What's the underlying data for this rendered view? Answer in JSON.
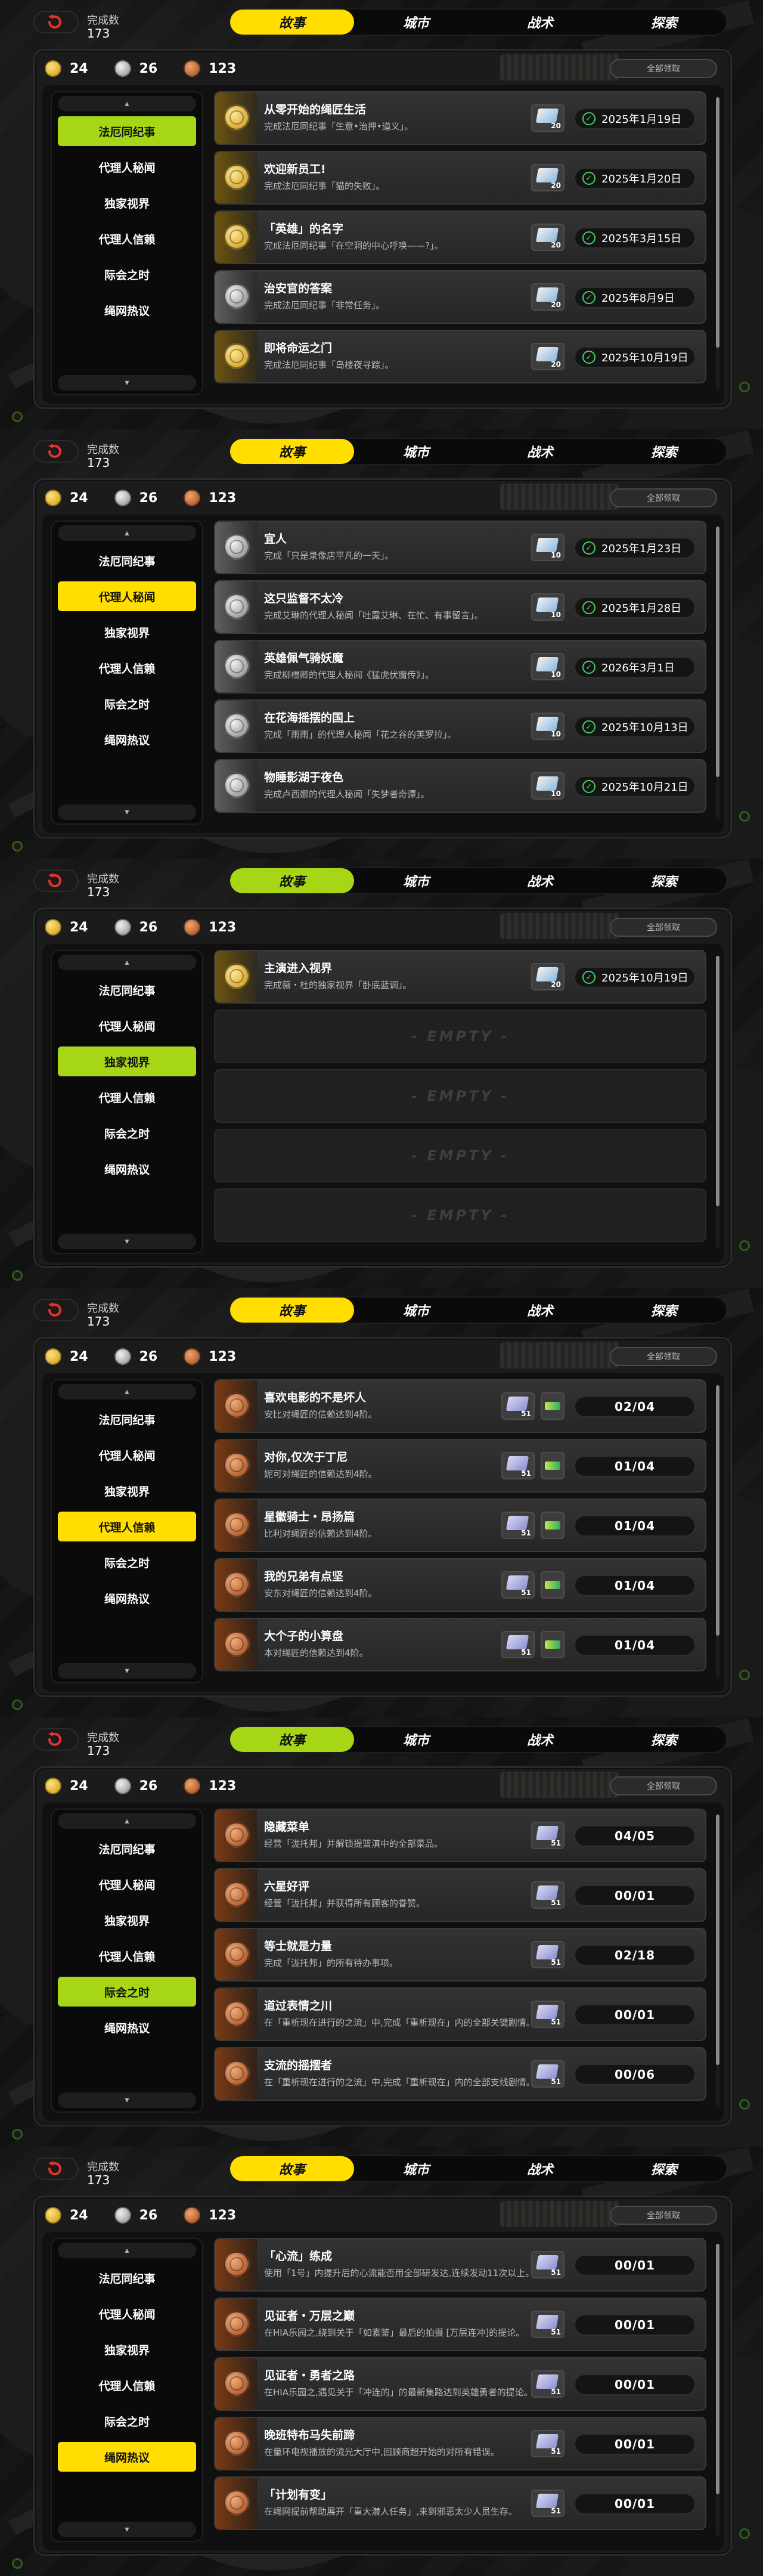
{
  "common": {
    "complete_label": "完成数",
    "complete_value": "173",
    "tabs": [
      "故事",
      "城市",
      "战术",
      "探索"
    ],
    "currency": [
      "24",
      "26",
      "123"
    ],
    "claim_all": "全部领取",
    "sidebar": [
      "法厄同纪事",
      "代理人秘闻",
      "独家视界",
      "代理人信赖",
      "际会之时",
      "绳网热议"
    ],
    "empty_label": "- EMPTY -"
  },
  "screens": [
    {
      "active_side": 0,
      "tab_style": "yellow",
      "side_style": "green",
      "rows": [
        {
          "medal": "gold",
          "title": "从零开始的绳匠生活",
          "desc": "完成法厄同纪事「生意•治押•道义」。",
          "reward_count": "20",
          "date": "2025年1月19日"
        },
        {
          "medal": "gold",
          "title": "欢迎新员工!",
          "desc": "完成法厄同纪事「猫的失败」。",
          "reward_count": "20",
          "date": "2025年1月20日"
        },
        {
          "medal": "gold",
          "title": "「英雄」的名字",
          "desc": "完成法厄同纪事「在空洞的中心呼唤——?」。",
          "reward_count": "20",
          "date": "2025年3月15日"
        },
        {
          "medal": "silver",
          "title": "治安官的答案",
          "desc": "完成法厄同纪事「非常任务」。",
          "reward_count": "20",
          "date": "2025年8月9日"
        },
        {
          "medal": "gold",
          "title": "即将命运之门",
          "desc": "完成法厄同纪事「岛楼夜寻踪」。",
          "reward_count": "20",
          "date": "2025年10月19日"
        }
      ]
    },
    {
      "active_side": 1,
      "tab_style": "yellow",
      "side_style": "yellow",
      "rows": [
        {
          "medal": "silver",
          "title": "宜人",
          "desc": "完成「只是录像店平凡的一天」。",
          "reward_count": "10",
          "date": "2025年1月23日"
        },
        {
          "medal": "silver",
          "title": "这只监督不太冷",
          "desc": "完成艾琳的代理人秘闻「吐露艾琳、在忙、有事留言」。",
          "reward_count": "10",
          "date": "2025年1月28日"
        },
        {
          "medal": "silver",
          "title": "英雄佩气骑妖魔",
          "desc": "完成柳榻卿的代理人秘闻《猛虎伏魔传》」。",
          "reward_count": "10",
          "date": "2026年3月1日"
        },
        {
          "medal": "silver",
          "title": "在花海摇摆的国上",
          "desc": "完成「雨雨」的代理人秘闻「花之谷的芙罗拉」。",
          "reward_count": "10",
          "date": "2025年10月13日"
        },
        {
          "medal": "silver",
          "title": "物睡影湖于夜色",
          "desc": "完成卢西娜的代理人秘闻「失梦者奇谭」。",
          "reward_count": "10",
          "date": "2025年10月21日"
        }
      ]
    },
    {
      "active_side": 2,
      "tab_style": "green",
      "side_style": "green",
      "rows": [
        {
          "medal": "gold",
          "title": "主演进入视界",
          "desc": "完成薇・杜的独家视界「卧底蓝调」。",
          "reward_count": "20",
          "date": "2025年10月19日"
        },
        {
          "empty": true
        },
        {
          "empty": true
        },
        {
          "empty": true
        },
        {
          "empty": true
        }
      ]
    },
    {
      "active_side": 3,
      "tab_style": "yellow",
      "side_style": "yellow",
      "rows": [
        {
          "medal": "bronze",
          "title": "喜欢电影的不是坏人",
          "desc": "安比对绳匠的信赖达到4阶。",
          "reward_count": "51",
          "progress": "02/04"
        },
        {
          "medal": "bronze",
          "title": "对你,仅次于丁尼",
          "desc": "妮可对绳匠的信赖达到4阶。",
          "reward_count": "51",
          "progress": "01/04"
        },
        {
          "medal": "bronze",
          "title": "星徽骑士・昂扬篇",
          "desc": "比利对绳匠的信赖达到4阶。",
          "reward_count": "51",
          "progress": "01/04"
        },
        {
          "medal": "bronze",
          "title": "我的兄弟有点坚",
          "desc": "安东对绳匠的信赖达到4阶。",
          "reward_count": "51",
          "progress": "01/04"
        },
        {
          "medal": "bronze",
          "title": "大个子的小算盘",
          "desc": "本对绳匠的信赖达到4阶。",
          "reward_count": "51",
          "progress": "01/04"
        }
      ]
    },
    {
      "active_side": 4,
      "tab_style": "green",
      "side_style": "green",
      "rows": [
        {
          "medal": "bronze",
          "title": "隐藏菜单",
          "desc": "经营「泷托邦」并解锁提篮滇中的全部菜品。",
          "reward_count": "51",
          "progress": "04/05"
        },
        {
          "medal": "bronze",
          "title": "六星好评",
          "desc": "经营「泷托邦」并获得所有顾客的眷赞。",
          "reward_count": "51",
          "progress": "00/01"
        },
        {
          "medal": "bronze",
          "title": "等士就是力量",
          "desc": "完成「泷托邦」的所有待办事项。",
          "reward_count": "51",
          "progress": "02/18"
        },
        {
          "medal": "bronze",
          "title": "道过表情之川",
          "desc": "在「重析现在进行的之流」中,完成「重析现在」内的全部关键剧情。",
          "reward_count": "51",
          "progress": "00/01"
        },
        {
          "medal": "bronze",
          "title": "支流的摇摆者",
          "desc": "在「重析现在进行的之流」中,完成「重析现在」内的全部支线剧情。",
          "reward_count": "51",
          "progress": "00/06"
        }
      ]
    },
    {
      "active_side": 5,
      "tab_style": "yellow",
      "side_style": "yellow",
      "rows": [
        {
          "medal": "bronze",
          "title": "「心流」练成",
          "desc": "使用「1号」内提升后的心流能否用全部研发达,连续发动11次以上。",
          "reward_count": "51",
          "progress": "00/01"
        },
        {
          "medal": "bronze",
          "title": "见证者・万层之巅",
          "desc": "在HIA乐园之,绕到关于「如素鉴」最后的拍摄 [万层连冲]的提论。",
          "reward_count": "51",
          "progress": "00/01"
        },
        {
          "medal": "bronze",
          "title": "见证者・勇者之路",
          "desc": "在HIA乐园之,遇见关于「冲连的」的最新集路达到英雄勇者的提论。",
          "reward_count": "51",
          "progress": "00/01"
        },
        {
          "medal": "bronze",
          "title": "晚班特布马失前蹄",
          "desc": "在量环电视播放的流光大厅中,回顾商超开始的对所有错误。",
          "reward_count": "51",
          "progress": "00/01"
        },
        {
          "medal": "bronze",
          "title": "「计划有变」",
          "desc": "在绳网提前帮助展开「重大潜人任务」,来到邪恶太少人员生存。",
          "reward_count": "51",
          "progress": "00/01"
        }
      ]
    }
  ]
}
